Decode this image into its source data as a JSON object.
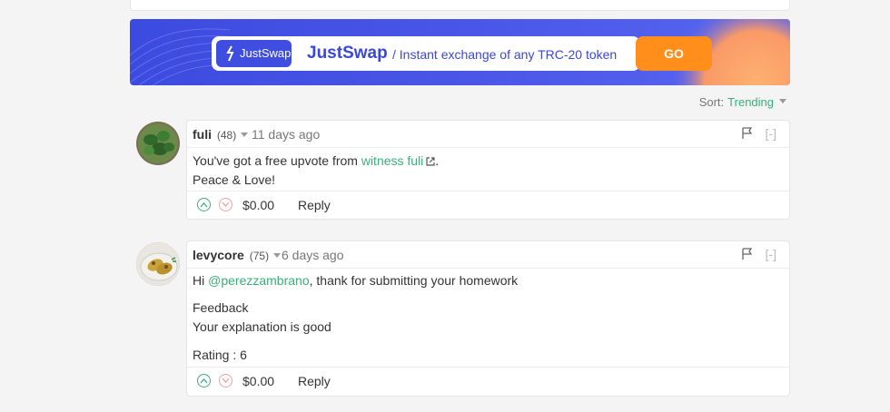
{
  "banner": {
    "logo_text": "JustSwap",
    "brand": "JustSwap",
    "tagline": "/ Instant exchange of any TRC-20 token",
    "cta": "GO"
  },
  "sort": {
    "label": "Sort:",
    "value": "Trending"
  },
  "comments": [
    {
      "author": "fuli",
      "reputation": "(48)",
      "time": "11 days ago",
      "collapse": "[-]",
      "body_prefix": "You've got a free upvote from ",
      "body_link": "witness fuli",
      "body_suffix": ".",
      "line2": "Peace & Love!",
      "payout": "$0.00",
      "reply": "Reply"
    },
    {
      "author": "levycore",
      "reputation": "(75)",
      "time": "6 days ago",
      "collapse": "[-]",
      "greeting": "Hi ",
      "mention": "@perezzambrano",
      "greeting_rest": ", thank for submitting your homework",
      "feedback_title": "Feedback",
      "feedback_text": "Your explanation is good",
      "rating": "Rating : 6",
      "payout": "$0.00",
      "reply": "Reply"
    }
  ]
}
